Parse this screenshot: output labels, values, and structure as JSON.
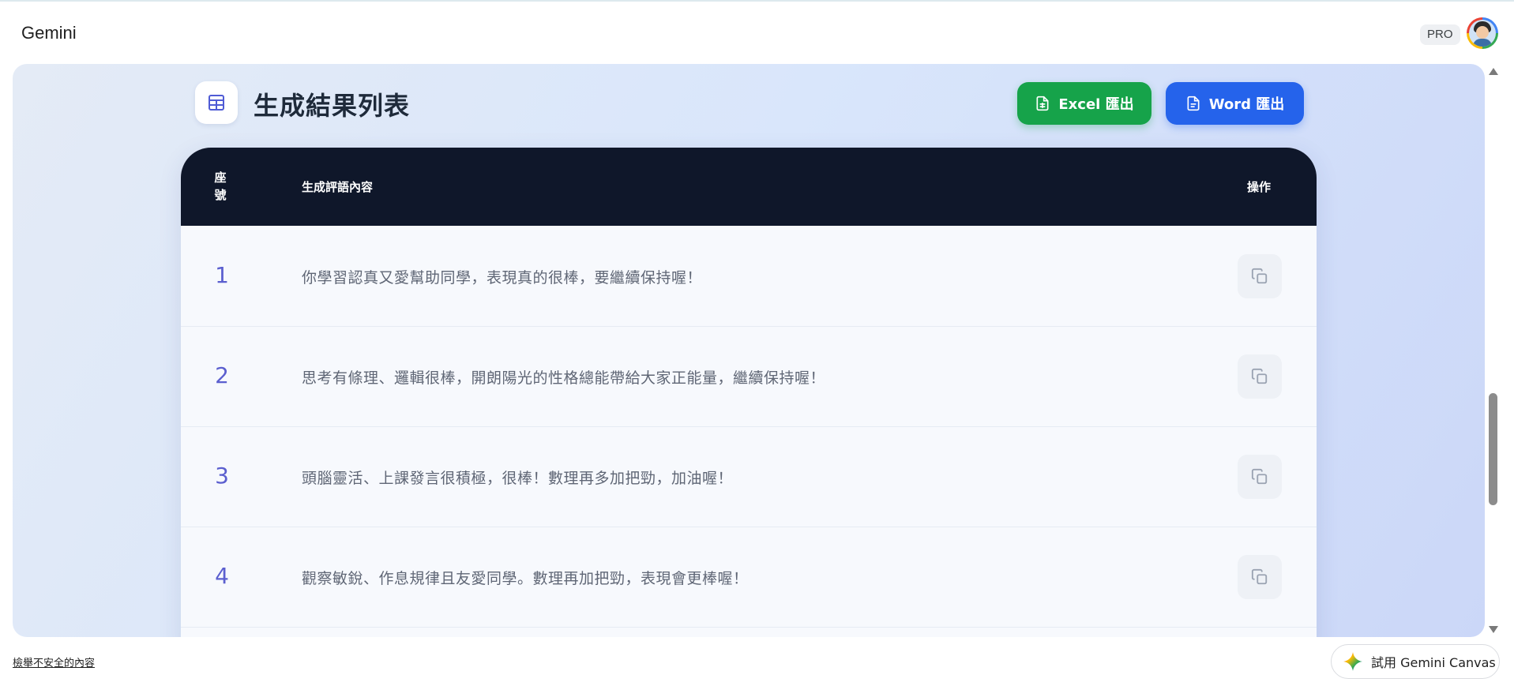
{
  "header": {
    "app_title": "Gemini",
    "pro_badge": "PRO",
    "avatar_icon": "user-avatar"
  },
  "canvas": {
    "title": "生成結果列表",
    "title_icon": "table-icon",
    "buttons": {
      "excel_label": "Excel 匯出",
      "word_label": "Word 匯出",
      "excel_color": "#16a34a",
      "word_color": "#2563eb"
    },
    "table": {
      "columns": {
        "seat": "座號",
        "content": "生成評語內容",
        "action": "操作"
      },
      "rows": [
        {
          "seat": "1",
          "comment": "你學習認真又愛幫助同學，表現真的很棒，要繼續保持喔！"
        },
        {
          "seat": "2",
          "comment": "思考有條理、邏輯很棒，開朗陽光的性格總能帶給大家正能量，繼續保持喔！"
        },
        {
          "seat": "3",
          "comment": "頭腦靈活、上課發言很積極，很棒！數理再多加把勁，加油喔！"
        },
        {
          "seat": "4",
          "comment": "觀察敏銳、作息規律且友愛同學。數理再加把勁，表現會更棒喔！"
        }
      ],
      "row_action_icon": "copy-icon",
      "header_color": "#0f172a",
      "seat_number_color": "#5b5fcf"
    }
  },
  "footer": {
    "report_link": "檢舉不安全的內容",
    "canvas_button_label": "試用 Gemini Canvas",
    "canvas_button_icon": "gemini-sparkle-icon"
  }
}
